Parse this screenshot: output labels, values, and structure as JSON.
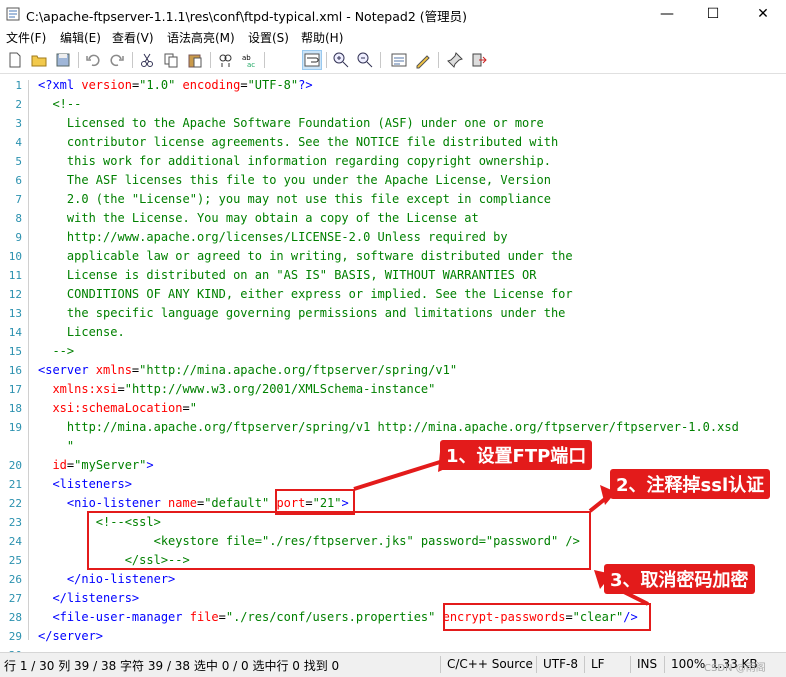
{
  "window": {
    "title": "C:\\apache-ftpserver-1.1.1\\res\\conf\\ftpd-typical.xml - Notepad2 (管理员)",
    "minimize": "—",
    "maximize": "☐",
    "close": "✕"
  },
  "menu": [
    "文件(F)",
    "编辑(E)",
    "查看(V)",
    "语法高亮(M)",
    "设置(S)",
    "帮助(H)"
  ],
  "toolbar_icons": [
    "new-icon",
    "open-icon",
    "save-icon",
    "undo-icon",
    "redo-icon",
    "cut-icon",
    "copy-icon",
    "paste-icon",
    "find-icon",
    "replace-icon",
    "wordwrap-icon",
    "zoom-in-icon",
    "zoom-out-icon",
    "scheme-icon",
    "customize-icon",
    "pin-icon",
    "exit-icon"
  ],
  "lines": [
    {
      "n": "1",
      "segs": [
        [
          "c-tag",
          "<"
        ],
        [
          "c-tag",
          "?xml "
        ],
        [
          "c-attr",
          "version"
        ],
        [
          "c-def",
          "="
        ],
        [
          "c-str",
          "\"1.0\""
        ],
        [
          "c-def",
          " "
        ],
        [
          "c-attr",
          "encoding"
        ],
        [
          "c-def",
          "="
        ],
        [
          "c-str",
          "\"UTF-8\""
        ],
        [
          "c-tag",
          "?"
        ],
        [
          "c-tag",
          ">"
        ]
      ]
    },
    {
      "n": "2",
      "segs": [
        [
          "c-com",
          "  <!--"
        ]
      ]
    },
    {
      "n": "3",
      "segs": [
        [
          "c-com",
          "    Licensed to the Apache Software Foundation (ASF) under one or more"
        ]
      ]
    },
    {
      "n": "4",
      "segs": [
        [
          "c-com",
          "    contributor license agreements. See the NOTICE file distributed with"
        ]
      ]
    },
    {
      "n": "5",
      "segs": [
        [
          "c-com",
          "    this work for additional information regarding copyright ownership."
        ]
      ]
    },
    {
      "n": "6",
      "segs": [
        [
          "c-com",
          "    The ASF licenses this file to you under the Apache License, Version"
        ]
      ]
    },
    {
      "n": "7",
      "segs": [
        [
          "c-com",
          "    2.0 (the \"License\"); you may not use this file except in compliance"
        ]
      ]
    },
    {
      "n": "8",
      "segs": [
        [
          "c-com",
          "    with the License. You may obtain a copy of the License at"
        ]
      ]
    },
    {
      "n": "9",
      "segs": [
        [
          "c-com",
          "    http://www.apache.org/licenses/LICENSE-2.0 Unless required by"
        ]
      ]
    },
    {
      "n": "10",
      "segs": [
        [
          "c-com",
          "    applicable law or agreed to in writing, software distributed under the"
        ]
      ]
    },
    {
      "n": "11",
      "segs": [
        [
          "c-com",
          "    License is distributed on an \"AS IS\" BASIS, WITHOUT WARRANTIES OR"
        ]
      ]
    },
    {
      "n": "12",
      "segs": [
        [
          "c-com",
          "    CONDITIONS OF ANY KIND, either express or implied. See the License for"
        ]
      ]
    },
    {
      "n": "13",
      "segs": [
        [
          "c-com",
          "    the specific language governing permissions and limitations under the"
        ]
      ]
    },
    {
      "n": "14",
      "segs": [
        [
          "c-com",
          "    License."
        ]
      ]
    },
    {
      "n": "15",
      "segs": [
        [
          "c-com",
          "  -->"
        ]
      ]
    },
    {
      "n": "16",
      "segs": [
        [
          "c-tag",
          "<server "
        ],
        [
          "c-attr",
          "xmlns"
        ],
        [
          "c-def",
          "="
        ],
        [
          "c-str",
          "\"http://mina.apache.org/ftpserver/spring/v1\""
        ]
      ]
    },
    {
      "n": "17",
      "segs": [
        [
          "c-attr",
          "  xmlns:xsi"
        ],
        [
          "c-def",
          "="
        ],
        [
          "c-str",
          "\"http://www.w3.org/2001/XMLSchema-instance\""
        ]
      ]
    },
    {
      "n": "18",
      "segs": [
        [
          "c-attr",
          "  xsi:schemaLocation"
        ],
        [
          "c-def",
          "="
        ],
        [
          "c-str",
          "\""
        ]
      ]
    },
    {
      "n": "19",
      "segs": [
        [
          "c-str",
          "    http://mina.apache.org/ftpserver/spring/v1 http://mina.apache.org/ftpserver/ftpserver-1.0.xsd"
        ]
      ]
    },
    {
      "n": "",
      "segs": [
        [
          "c-str",
          "    \""
        ]
      ]
    },
    {
      "n": "20",
      "segs": [
        [
          "c-attr",
          "  id"
        ],
        [
          "c-def",
          "="
        ],
        [
          "c-str",
          "\"myServer\""
        ],
        [
          "c-tag",
          ">"
        ]
      ]
    },
    {
      "n": "21",
      "segs": [
        [
          "c-tag",
          "  <listeners>"
        ]
      ]
    },
    {
      "n": "22",
      "segs": [
        [
          "c-tag",
          "    <nio-listener "
        ],
        [
          "c-attr",
          "name"
        ],
        [
          "c-def",
          "="
        ],
        [
          "c-str",
          "\"default\""
        ],
        [
          "c-def",
          " "
        ],
        [
          "c-attr",
          "port"
        ],
        [
          "c-def",
          "="
        ],
        [
          "c-str",
          "\"21\""
        ],
        [
          "c-tag",
          ">"
        ]
      ]
    },
    {
      "n": "23",
      "segs": [
        [
          "c-com",
          "        <!--<ssl>"
        ]
      ]
    },
    {
      "n": "24",
      "segs": [
        [
          "c-com",
          "                <keystore file=\"./res/ftpserver.jks\" password=\"password\" />"
        ]
      ]
    },
    {
      "n": "25",
      "segs": [
        [
          "c-com",
          "            </ssl>-->"
        ]
      ]
    },
    {
      "n": "26",
      "segs": [
        [
          "c-tag",
          "    </nio-listener>"
        ]
      ]
    },
    {
      "n": "27",
      "segs": [
        [
          "c-tag",
          "  </listeners>"
        ]
      ]
    },
    {
      "n": "28",
      "segs": [
        [
          "c-tag",
          "  <file-user-manager "
        ],
        [
          "c-attr",
          "file"
        ],
        [
          "c-def",
          "="
        ],
        [
          "c-str",
          "\"./res/conf/users.properties\""
        ],
        [
          "c-def",
          " "
        ],
        [
          "c-attr",
          "encrypt-passwords"
        ],
        [
          "c-def",
          "="
        ],
        [
          "c-str",
          "\"clear\""
        ],
        [
          "c-tag",
          "/>"
        ]
      ]
    },
    {
      "n": "29",
      "segs": [
        [
          "c-tag",
          "</server>"
        ]
      ]
    },
    {
      "n": "30",
      "segs": []
    }
  ],
  "annotations": {
    "a1": "1、设置FTP端口",
    "a2": "2、注释掉ssl认证",
    "a3": "3、取消密码加密"
  },
  "status": {
    "pos": "行 1 / 30  列 39 / 38  字符 39 / 38  选中 0 / 0  选中行 0  找到 0",
    "scheme": "C/C++ Source",
    "encoding": "UTF-8",
    "eol": "LF",
    "ins": "INS",
    "zoom": "100%",
    "size": "1.33 KB",
    "watermark": "CSDN @雨阁"
  },
  "colors": {
    "accent_red": "#e31b1b",
    "tag": "#0000ff",
    "attr": "#ff0000",
    "string": "#008000",
    "comment": "#008000"
  }
}
